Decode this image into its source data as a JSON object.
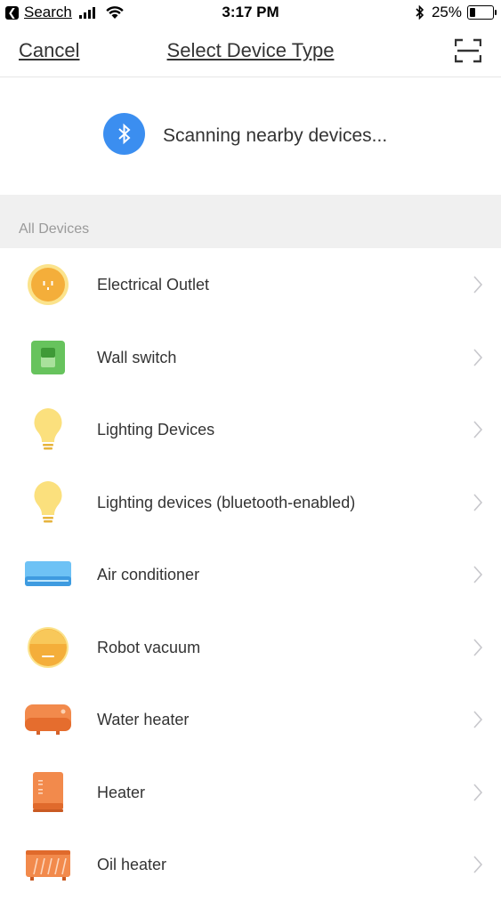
{
  "status_bar": {
    "back_app": "Search",
    "time": "3:17 PM",
    "battery_percent": "25%",
    "battery_level": 0.25
  },
  "nav": {
    "cancel_label": "Cancel",
    "title": "Select Device Type",
    "scan_icon": "qr-scan-icon"
  },
  "scanning": {
    "text": "Scanning nearby devices...",
    "icon": "bluetooth-icon",
    "accent": "#3b8ef0"
  },
  "section": {
    "label": "All Devices"
  },
  "devices": [
    {
      "label": "Electrical Outlet",
      "icon": "outlet-icon"
    },
    {
      "label": "Wall switch",
      "icon": "wall-switch-icon"
    },
    {
      "label": "Lighting Devices",
      "icon": "bulb-icon"
    },
    {
      "label": "Lighting devices (bluetooth-enabled)",
      "icon": "bulb-icon"
    },
    {
      "label": "Air conditioner",
      "icon": "air-conditioner-icon"
    },
    {
      "label": "Robot vacuum",
      "icon": "robot-vacuum-icon"
    },
    {
      "label": "Water heater",
      "icon": "water-heater-icon"
    },
    {
      "label": "Heater",
      "icon": "heater-icon"
    },
    {
      "label": "Oil heater",
      "icon": "oil-heater-icon"
    }
  ]
}
